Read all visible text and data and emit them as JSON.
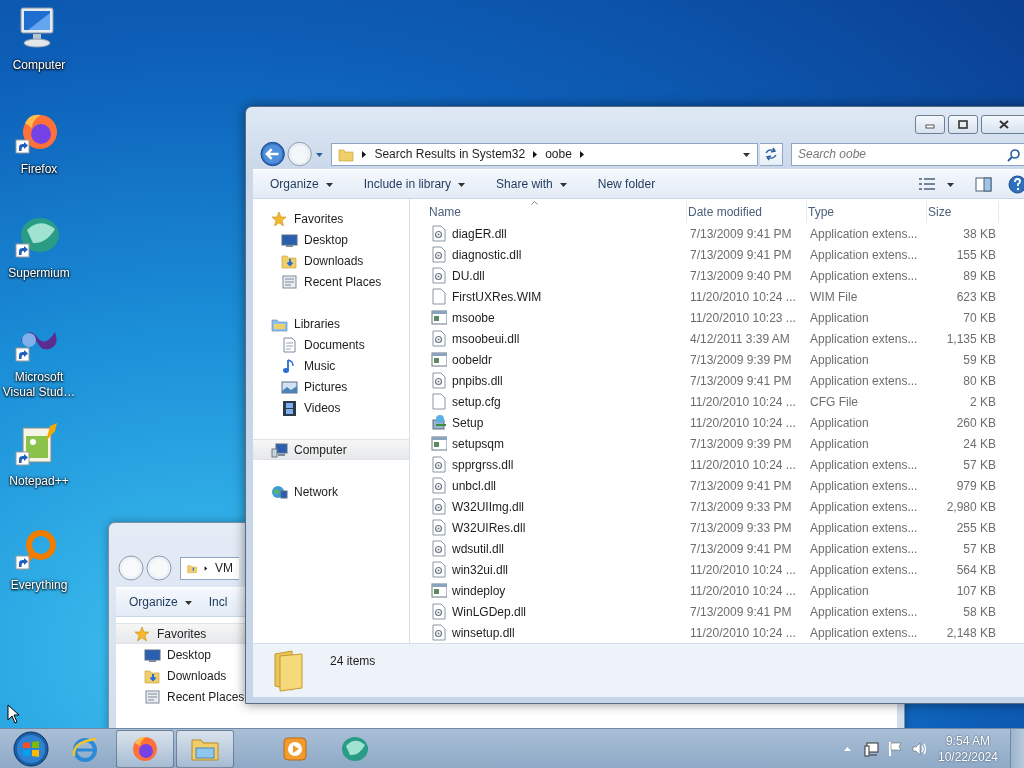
{
  "desktop_icons": [
    {
      "label": "Computer",
      "kind": "computer",
      "shortcut": false
    },
    {
      "label": "Firefox",
      "kind": "firefox",
      "shortcut": true
    },
    {
      "label": "Supermium",
      "kind": "supermium",
      "shortcut": true
    },
    {
      "label": "Microsoft Visual Stud…",
      "kind": "vstudio",
      "shortcut": true
    },
    {
      "label": "Notepad++",
      "kind": "notepad",
      "shortcut": true
    },
    {
      "label": "Everything",
      "kind": "everything",
      "shortcut": true
    }
  ],
  "back_window": {
    "address": "VM",
    "toolbar": [
      {
        "label": "Organize",
        "menu": true
      },
      {
        "label": "Incl",
        "menu": false
      }
    ],
    "nav": [
      {
        "label": "Favorites",
        "kind": "favorites",
        "selected": true,
        "children": [
          {
            "label": "Desktop",
            "kind": "desktop",
            "selected": false
          },
          {
            "label": "Downloads",
            "kind": "downloads",
            "selected": false
          },
          {
            "label": "Recent Places",
            "kind": "recent",
            "selected": false
          }
        ]
      }
    ]
  },
  "window": {
    "address": [
      "Search Results in System32",
      "oobe"
    ],
    "search": {
      "placeholder": "Search oobe"
    },
    "toolbar": [
      {
        "label": "Organize",
        "menu": true
      },
      {
        "label": "Include in library",
        "menu": true
      },
      {
        "label": "Share with",
        "menu": true
      },
      {
        "label": "New folder",
        "menu": false
      }
    ],
    "nav": [
      {
        "label": "Favorites",
        "kind": "favorites",
        "selected": false,
        "children": [
          {
            "label": "Desktop",
            "kind": "desktop",
            "selected": false
          },
          {
            "label": "Downloads",
            "kind": "downloads",
            "selected": false
          },
          {
            "label": "Recent Places",
            "kind": "recent",
            "selected": false
          }
        ]
      },
      {
        "label": "Libraries",
        "kind": "libraries",
        "selected": false,
        "children": [
          {
            "label": "Documents",
            "kind": "documents",
            "selected": false
          },
          {
            "label": "Music",
            "kind": "music",
            "selected": false
          },
          {
            "label": "Pictures",
            "kind": "pictures",
            "selected": false
          },
          {
            "label": "Videos",
            "kind": "videos",
            "selected": false
          }
        ]
      },
      {
        "label": "Computer",
        "kind": "computer",
        "selected": true
      },
      {
        "label": "Network",
        "kind": "network",
        "selected": false
      }
    ],
    "columns": [
      "Name",
      "Date modified",
      "Type",
      "Size"
    ],
    "files": [
      {
        "name": "diagER.dll",
        "kind": "dll",
        "date": "7/13/2009 9:41 PM",
        "type": "Application extens...",
        "size": "38 KB"
      },
      {
        "name": "diagnostic.dll",
        "kind": "dll",
        "date": "7/13/2009 9:41 PM",
        "type": "Application extens...",
        "size": "155 KB"
      },
      {
        "name": "DU.dll",
        "kind": "dll",
        "date": "7/13/2009 9:40 PM",
        "type": "Application extens...",
        "size": "89 KB"
      },
      {
        "name": "FirstUXRes.WIM",
        "kind": "file",
        "date": "11/20/2010 10:24 ...",
        "type": "WIM File",
        "size": "623 KB"
      },
      {
        "name": "msoobe",
        "kind": "exe",
        "date": "11/20/2010 10:23 ...",
        "type": "Application",
        "size": "70 KB"
      },
      {
        "name": "msoobeui.dll",
        "kind": "dll",
        "date": "4/12/2011 3:39 AM",
        "type": "Application extens...",
        "size": "1,135 KB"
      },
      {
        "name": "oobeldr",
        "kind": "exe",
        "date": "7/13/2009 9:39 PM",
        "type": "Application",
        "size": "59 KB"
      },
      {
        "name": "pnpibs.dll",
        "kind": "dll",
        "date": "7/13/2009 9:41 PM",
        "type": "Application extens...",
        "size": "80 KB"
      },
      {
        "name": "setup.cfg",
        "kind": "file",
        "date": "11/20/2010 10:24 ...",
        "type": "CFG File",
        "size": "2 KB"
      },
      {
        "name": "Setup",
        "kind": "setup",
        "date": "11/20/2010 10:24 ...",
        "type": "Application",
        "size": "260 KB"
      },
      {
        "name": "setupsqm",
        "kind": "exe",
        "date": "7/13/2009 9:39 PM",
        "type": "Application",
        "size": "24 KB"
      },
      {
        "name": "spprgrss.dll",
        "kind": "dll",
        "date": "11/20/2010 10:24 ...",
        "type": "Application extens...",
        "size": "57 KB"
      },
      {
        "name": "unbcl.dll",
        "kind": "dll",
        "date": "7/13/2009 9:41 PM",
        "type": "Application extens...",
        "size": "979 KB"
      },
      {
        "name": "W32UIImg.dll",
        "kind": "dll",
        "date": "7/13/2009 9:33 PM",
        "type": "Application extens...",
        "size": "2,980 KB"
      },
      {
        "name": "W32UIRes.dll",
        "kind": "dll",
        "date": "7/13/2009 9:33 PM",
        "type": "Application extens...",
        "size": "255 KB"
      },
      {
        "name": "wdsutil.dll",
        "kind": "dll",
        "date": "7/13/2009 9:41 PM",
        "type": "Application extens...",
        "size": "57 KB"
      },
      {
        "name": "win32ui.dll",
        "kind": "dll",
        "date": "11/20/2010 10:24 ...",
        "type": "Application extens...",
        "size": "564 KB"
      },
      {
        "name": "windeploy",
        "kind": "exe",
        "date": "11/20/2010 10:24 ...",
        "type": "Application",
        "size": "107 KB"
      },
      {
        "name": "WinLGDep.dll",
        "kind": "dll",
        "date": "7/13/2009 9:41 PM",
        "type": "Application extens...",
        "size": "58 KB"
      },
      {
        "name": "winsetup.dll",
        "kind": "dll",
        "date": "11/20/2010 10:24 ...",
        "type": "Application extens...",
        "size": "2,148 KB"
      }
    ],
    "status": "24 items"
  },
  "taskbar": {
    "items": [
      {
        "kind": "ie",
        "open": false
      },
      {
        "kind": "firefox",
        "open": true
      },
      {
        "kind": "explorer",
        "open": true
      },
      {
        "kind": "mediaplayer",
        "open": false
      },
      {
        "kind": "supermium",
        "open": false
      }
    ],
    "time": "9:54 AM",
    "date": "10/22/2024"
  }
}
